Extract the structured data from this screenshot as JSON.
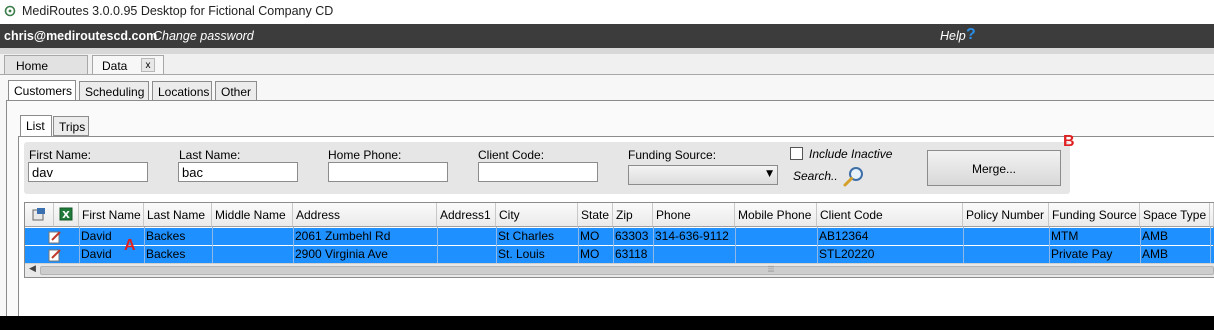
{
  "window": {
    "title": "MediRoutes 3.0.0.95 Desktop for Fictional Company CD"
  },
  "userbar": {
    "email": "chris@mediroutescd.com",
    "change_password": "Change password",
    "help": "Help",
    "help_icon": "?"
  },
  "doc_tabs": {
    "home": "Home",
    "data": "Data",
    "close": "x"
  },
  "main_tabs": [
    "Customers",
    "Scheduling",
    "Locations",
    "Other"
  ],
  "sub_tabs": [
    "List",
    "Trips"
  ],
  "filters": {
    "first_name_label": "First Name:",
    "first_name_value": "dav",
    "last_name_label": "Last Name:",
    "last_name_value": "bac",
    "home_phone_label": "Home Phone:",
    "home_phone_value": "",
    "client_code_label": "Client Code:",
    "client_code_value": "",
    "funding_source_label": "Funding Source:",
    "funding_source_value": "",
    "include_inactive_label": "Include Inactive",
    "search_label": "Search.."
  },
  "merge_button": "Merge...",
  "annotations": {
    "a": "A",
    "b": "B"
  },
  "grid": {
    "columns": [
      "First Name",
      "Last Name",
      "Middle Name",
      "Address",
      "Address1",
      "City",
      "State",
      "Zip",
      "Phone",
      "Mobile Phone",
      "Client Code",
      "Policy Number",
      "Funding Source",
      "Space Type"
    ],
    "rows": [
      [
        "David",
        "Backes",
        "",
        "2061 Zumbehl Rd",
        "",
        "St Charles",
        "MO",
        "63303",
        "314-636-9112",
        "",
        "AB12364",
        "",
        "MTM",
        "AMB"
      ],
      [
        "David",
        "Backes",
        "",
        "2900 Virginia Ave",
        "",
        "St. Louis",
        "MO",
        "63118",
        "",
        "",
        "STL20220",
        "",
        "Private Pay",
        "AMB"
      ]
    ],
    "selected_row_color": "#1e90ff"
  },
  "colors": {
    "userbar_bg": "#3c3c3c",
    "selection": "#1e90ff",
    "annotation": "#e02020",
    "help_icon": "#2a8ee8"
  }
}
